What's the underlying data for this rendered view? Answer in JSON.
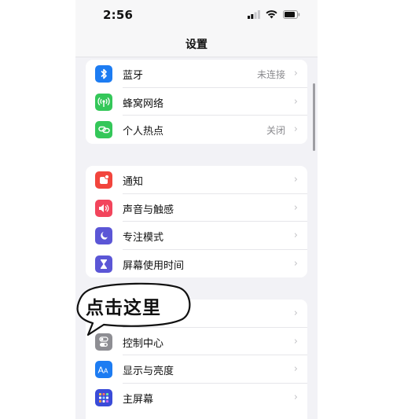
{
  "status_bar": {
    "time": "2:56"
  },
  "nav": {
    "title": "设置"
  },
  "groups": [
    {
      "items": [
        {
          "label": "蓝牙",
          "value": "未连接",
          "icon": "bluetooth-icon",
          "color": "#1d7cf2"
        },
        {
          "label": "蜂窝网络",
          "value": "",
          "icon": "cellular-icon",
          "color": "#34c759"
        },
        {
          "label": "个人热点",
          "value": "关闭",
          "icon": "hotspot-icon",
          "color": "#34c759"
        }
      ]
    },
    {
      "items": [
        {
          "label": "通知",
          "value": "",
          "icon": "notification-icon",
          "color": "#f2453d"
        },
        {
          "label": "声音与触感",
          "value": "",
          "icon": "sound-icon",
          "color": "#f2455c"
        },
        {
          "label": "专注模式",
          "value": "",
          "icon": "moon-icon",
          "color": "#5b56d6"
        },
        {
          "label": "屏幕使用时间",
          "value": "",
          "icon": "hourglass-icon",
          "color": "#5b56d6"
        }
      ]
    },
    {
      "items": [
        {
          "label": "",
          "value": "",
          "icon": "general-icon",
          "color": "#8e8e93"
        },
        {
          "label": "控制中心",
          "value": "",
          "icon": "control-center-icon",
          "color": "#8e8e93"
        },
        {
          "label": "显示与亮度",
          "value": "",
          "icon": "display-icon",
          "color": "#1d7cf2"
        },
        {
          "label": "主屏幕",
          "value": "",
          "icon": "home-screen-icon",
          "color": "#3a4bd8"
        }
      ]
    }
  ],
  "callout": {
    "text": "点击这里"
  },
  "chevron": "›"
}
